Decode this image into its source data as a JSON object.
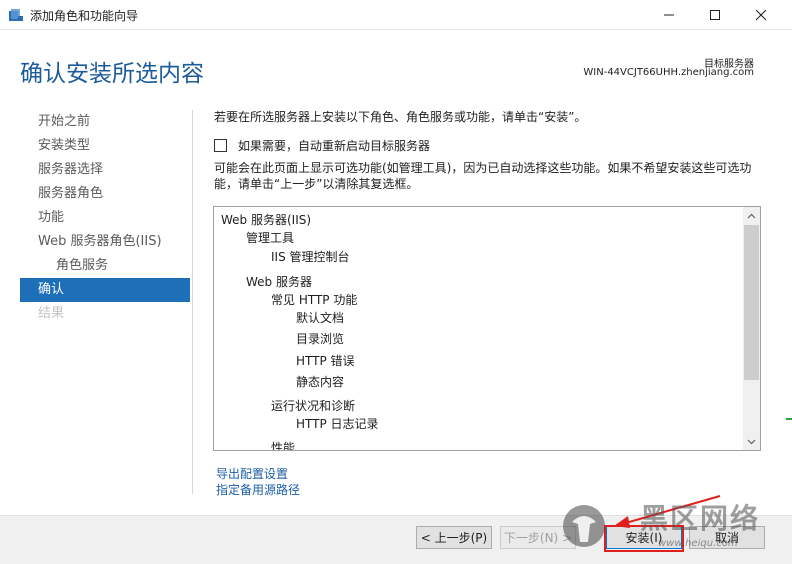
{
  "window": {
    "title": "添加角色和功能向导",
    "minimize_icon": "minimize-icon",
    "maximize_icon": "maximize-icon",
    "close_icon": "close-icon"
  },
  "header": {
    "page_title": "确认安装所选内容",
    "target_label": "目标服务器",
    "target_server": "WIN-44VCJT66UHH.zhenjiang.com"
  },
  "nav": {
    "items": [
      {
        "label": "开始之前",
        "state": "normal"
      },
      {
        "label": "安装类型",
        "state": "normal"
      },
      {
        "label": "服务器选择",
        "state": "normal"
      },
      {
        "label": "服务器角色",
        "state": "normal"
      },
      {
        "label": "功能",
        "state": "normal"
      },
      {
        "label": "Web 服务器角色(IIS)",
        "state": "normal"
      },
      {
        "label": "角色服务",
        "state": "sub"
      },
      {
        "label": "确认",
        "state": "active"
      },
      {
        "label": "结果",
        "state": "disabled"
      }
    ]
  },
  "main": {
    "intro": "若要在所选服务器上安装以下角色、角色服务或功能，请单击“安装”。",
    "restart_label": "如果需要，自动重新启动目标服务器",
    "restart_checked": false,
    "optional_note": "可能会在此页面上显示可选功能(如管理工具)，因为已自动选择这些功能。如果不希望安装这些可选功能，请单击“上一步”以清除其复选框。",
    "features": [
      "Web 服务器(IIS)",
      "管理工具",
      "IIS 管理控制台",
      "Web 服务器",
      "常见 HTTP 功能",
      "默认文档",
      "目录浏览",
      "HTTP 错误",
      "静态内容",
      "运行状况和诊断",
      "HTTP 日志记录",
      "性能"
    ],
    "export_link": "导出配置设置",
    "source_link": "指定备用源路径"
  },
  "footer": {
    "prev": "< 上一步(P)",
    "next": "下一步(N) >",
    "install": "安装(I)",
    "cancel": "取消"
  },
  "watermark": {
    "brand": "黑区网络",
    "url": "www.heiqu.com"
  },
  "colors": {
    "accent": "#1d6fb8",
    "title": "#1c5b9c",
    "link": "#1d5ea8",
    "highlight": "#e0201c"
  }
}
